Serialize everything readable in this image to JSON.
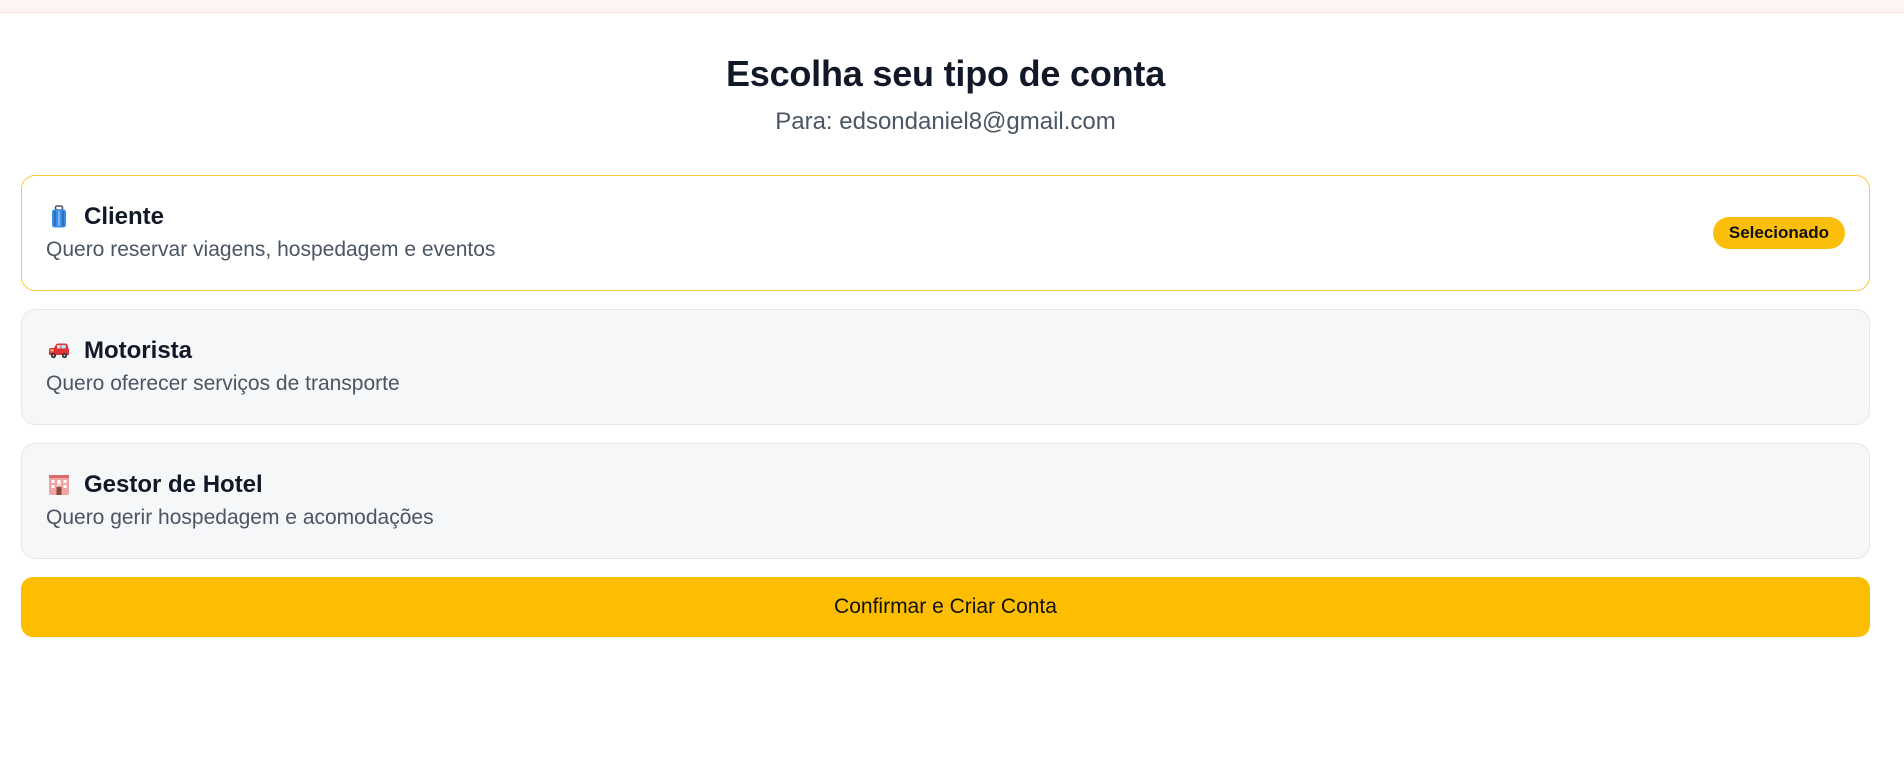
{
  "header": {
    "title": "Escolha seu tipo de conta",
    "subtitle": "Para: edsondaniel8@gmail.com"
  },
  "options": [
    {
      "icon": "luggage-icon",
      "title": "Cliente",
      "description": "Quero reservar viagens, hospedagem e eventos",
      "selected": true,
      "badge": "Selecionado"
    },
    {
      "icon": "car-icon",
      "title": "Motorista",
      "description": "Quero oferecer serviços de transporte",
      "selected": false
    },
    {
      "icon": "hotel-icon",
      "title": "Gestor de Hotel",
      "description": "Quero gerir hospedagem e acomodações",
      "selected": false
    }
  ],
  "actions": {
    "confirm_label": "Confirmar e Criar Conta"
  },
  "colors": {
    "accent": "#fdbd00",
    "selected_border": "#fcc93a",
    "card_background": "#f6f7f8",
    "top_strip": "#fff5f5"
  }
}
